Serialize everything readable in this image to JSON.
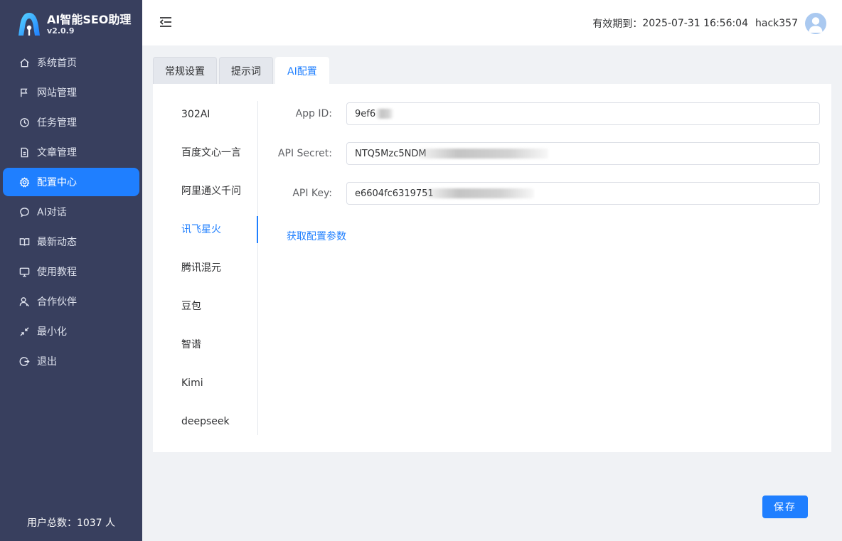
{
  "app": {
    "title": "AI智能SEO助理",
    "version": "v2.0.9"
  },
  "header": {
    "expiry_label": "有效期到：",
    "expiry_value": "2025-07-31 16:56:04",
    "username": "hack357"
  },
  "sidebar": {
    "items": [
      {
        "label": "系统首页",
        "icon": "home-icon"
      },
      {
        "label": "网站管理",
        "icon": "flag-icon"
      },
      {
        "label": "任务管理",
        "icon": "clock-icon"
      },
      {
        "label": "文章管理",
        "icon": "document-icon"
      },
      {
        "label": "配置中心",
        "icon": "gear-icon",
        "active": true
      },
      {
        "label": "AI对话",
        "icon": "chat-icon"
      },
      {
        "label": "最新动态",
        "icon": "book-icon"
      },
      {
        "label": "使用教程",
        "icon": "monitor-icon"
      },
      {
        "label": "合作伙伴",
        "icon": "partner-icon"
      },
      {
        "label": "最小化",
        "icon": "minimize-icon"
      },
      {
        "label": "退出",
        "icon": "logout-icon"
      }
    ],
    "user_count": "用户总数：1037 人"
  },
  "tabs": [
    {
      "label": "常规设置"
    },
    {
      "label": "提示词"
    },
    {
      "label": "AI配置",
      "active": true
    }
  ],
  "providers": [
    {
      "label": "302AI"
    },
    {
      "label": "百度文心一言"
    },
    {
      "label": "阿里通义千问"
    },
    {
      "label": "讯飞星火",
      "active": true
    },
    {
      "label": "腾讯混元"
    },
    {
      "label": "豆包"
    },
    {
      "label": "智谱"
    },
    {
      "label": "Kimi"
    },
    {
      "label": "deepseek"
    }
  ],
  "form": {
    "app_id_label": "App ID:",
    "app_id_value": "9ef6",
    "api_secret_label": "API Secret:",
    "api_secret_value": "NTQ5Mzc5NDM",
    "api_key_label": "API Key:",
    "api_key_value": "e6604fc6319751",
    "config_link": "获取配置参数"
  },
  "save_label": "保存",
  "colors": {
    "sidebar_bg": "#383f5e",
    "accent": "#1f7fff"
  }
}
